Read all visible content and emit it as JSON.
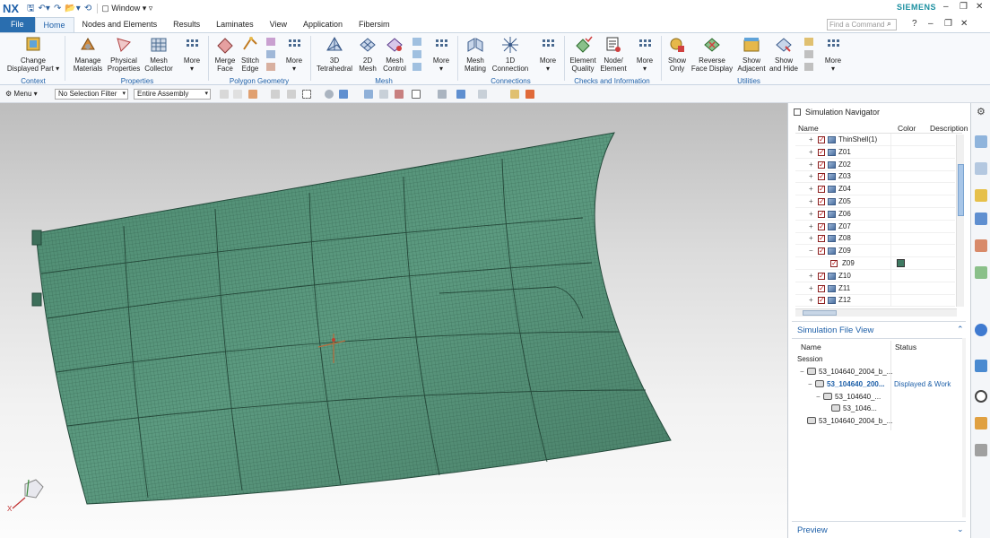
{
  "app": {
    "logo": "NX",
    "window_menu": "Window",
    "brand": "SIEMENS",
    "find_command_placeholder": "Find a Command"
  },
  "tabs": [
    "File",
    "Home",
    "Nodes and Elements",
    "Results",
    "Laminates",
    "View",
    "Application",
    "Fibersim"
  ],
  "ribbon": {
    "buttons": [
      {
        "line1": "Change",
        "line2": "Displayed Part ▾"
      },
      {
        "line1": "Manage",
        "line2": "Materials"
      },
      {
        "line1": "Physical",
        "line2": "Properties"
      },
      {
        "line1": "Mesh",
        "line2": "Collector"
      },
      {
        "line1": "More",
        "line2": "▾"
      },
      {
        "line1": "Merge",
        "line2": "Face"
      },
      {
        "line1": "Stitch",
        "line2": "Edge"
      },
      {
        "line1": "More",
        "line2": "▾"
      },
      {
        "line1": "3D",
        "line2": "Tetrahedral"
      },
      {
        "line1": "2D",
        "line2": "Mesh"
      },
      {
        "line1": "Mesh",
        "line2": "Control"
      },
      {
        "line1": "More",
        "line2": "▾"
      },
      {
        "line1": "Mesh",
        "line2": "Mating"
      },
      {
        "line1": "1D",
        "line2": "Connection"
      },
      {
        "line1": "More",
        "line2": "▾"
      },
      {
        "line1": "Element",
        "line2": "Quality"
      },
      {
        "line1": "Node/",
        "line2": "Element"
      },
      {
        "line1": "More",
        "line2": "▾"
      },
      {
        "line1": "Show",
        "line2": "Only"
      },
      {
        "line1": "Reverse",
        "line2": "Face Display"
      },
      {
        "line1": "Show",
        "line2": "Adjacent"
      },
      {
        "line1": "Show",
        "line2": "and Hide"
      },
      {
        "line1": "More",
        "line2": "▾"
      }
    ],
    "groups": [
      "Context",
      "Properties",
      "Polygon Geometry",
      "Mesh",
      "Connections",
      "Checks and Information",
      "Utilities"
    ]
  },
  "selection_bar": {
    "menu_label": "Menu ▾",
    "filter": "No Selection Filter",
    "scope": "Entire Assembly"
  },
  "navigator": {
    "title": "Simulation Navigator",
    "columns": [
      "Name",
      "Color",
      "Description"
    ],
    "rows": [
      {
        "label": "ThinShell(1)",
        "expander": "+",
        "indent": 0
      },
      {
        "label": "Z01",
        "expander": "+",
        "indent": 0
      },
      {
        "label": "Z02",
        "expander": "+",
        "indent": 0
      },
      {
        "label": "Z03",
        "expander": "+",
        "indent": 0
      },
      {
        "label": "Z04",
        "expander": "+",
        "indent": 0
      },
      {
        "label": "Z05",
        "expander": "+",
        "indent": 0
      },
      {
        "label": "Z06",
        "expander": "+",
        "indent": 0
      },
      {
        "label": "Z07",
        "expander": "+",
        "indent": 0
      },
      {
        "label": "Z08",
        "expander": "+",
        "indent": 0
      },
      {
        "label": "Z09",
        "expander": "−",
        "indent": 0
      },
      {
        "label": "Z09",
        "expander": "",
        "indent": 1,
        "color": "#3f7a62"
      },
      {
        "label": "Z10",
        "expander": "+",
        "indent": 0
      },
      {
        "label": "Z11",
        "expander": "+",
        "indent": 0
      },
      {
        "label": "Z12",
        "expander": "+",
        "indent": 0
      }
    ]
  },
  "sim_file_view": {
    "title": "Simulation File View",
    "columns": [
      "Name",
      "Status"
    ],
    "session_label": "Session",
    "rows": [
      {
        "label": "53_104640_2004_b_...",
        "status": "",
        "indent": 1,
        "expander": "−"
      },
      {
        "label": "53_104640_200...",
        "status": "Displayed & Work",
        "indent": 2,
        "expander": "−",
        "bold": true
      },
      {
        "label": "53_104640_...",
        "status": "",
        "indent": 3,
        "expander": "−"
      },
      {
        "label": "53_1046...",
        "status": "",
        "indent": 4,
        "expander": ""
      },
      {
        "label": "53_104640_2004_b_...",
        "status": "",
        "indent": 1,
        "expander": ""
      }
    ]
  },
  "preview_title": "Preview",
  "triad_label": "X",
  "colors": {
    "mesh": "#4f8c72",
    "mesh_line": "#2c5a48",
    "accent": "#1d5fa8",
    "file_tab": "#2a6eaf"
  }
}
